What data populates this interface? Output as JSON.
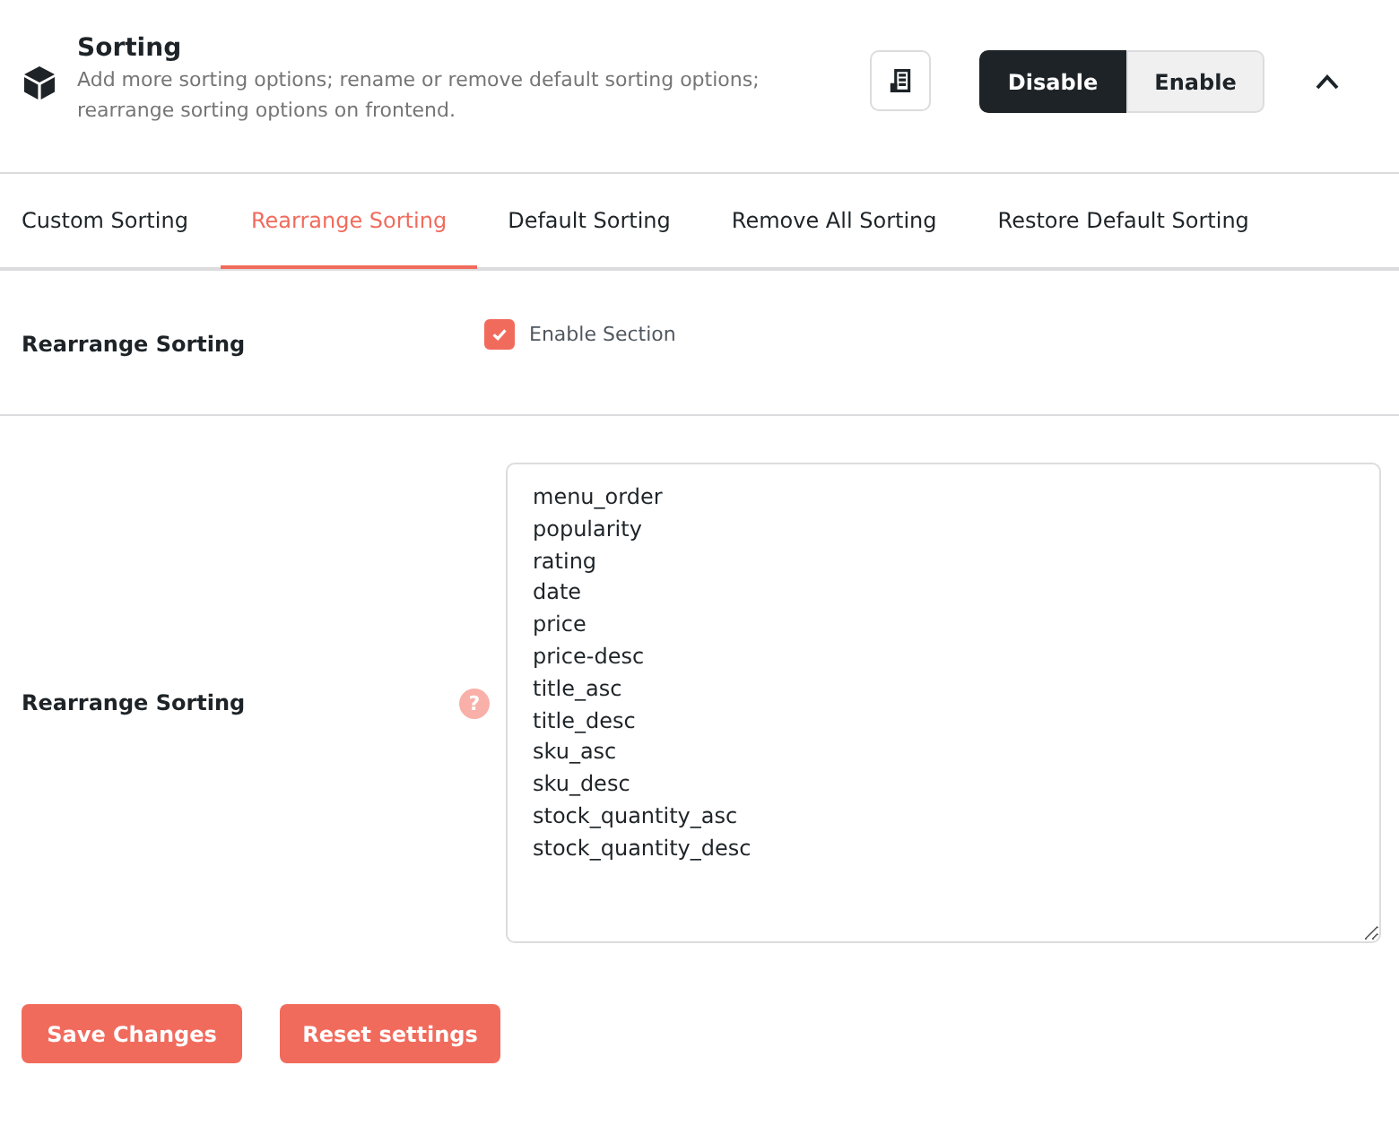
{
  "header": {
    "title": "Sorting",
    "description": "Add more sorting options; rename or remove default sorting options; rearrange sorting options on frontend.",
    "toggle": [
      {
        "label": "Disable",
        "selected": true
      },
      {
        "label": "Enable",
        "selected": false
      }
    ],
    "expanded": true
  },
  "tabs": [
    {
      "label": "Custom Sorting",
      "selected": false
    },
    {
      "label": "Rearrange Sorting",
      "selected": true
    },
    {
      "label": "Default Sorting",
      "selected": false
    },
    {
      "label": "Remove All Sorting",
      "selected": false
    },
    {
      "label": "Restore Default Sorting",
      "selected": false
    }
  ],
  "settings": [
    {
      "kind": "checkbox",
      "label": "Rearrange Sorting",
      "option": "Enable Section",
      "checked": true
    },
    {
      "kind": "textarea",
      "label": "Rearrange Sorting",
      "help": "?",
      "value": [
        "menu_order",
        "popularity",
        "rating",
        "date",
        "price",
        "price-desc",
        "title_asc",
        "title_desc",
        "sku_asc",
        "sku_desc",
        "stock_quantity_asc",
        "stock_quantity_desc"
      ]
    }
  ],
  "buttons": [
    "Save Changes",
    "Reset settings"
  ]
}
